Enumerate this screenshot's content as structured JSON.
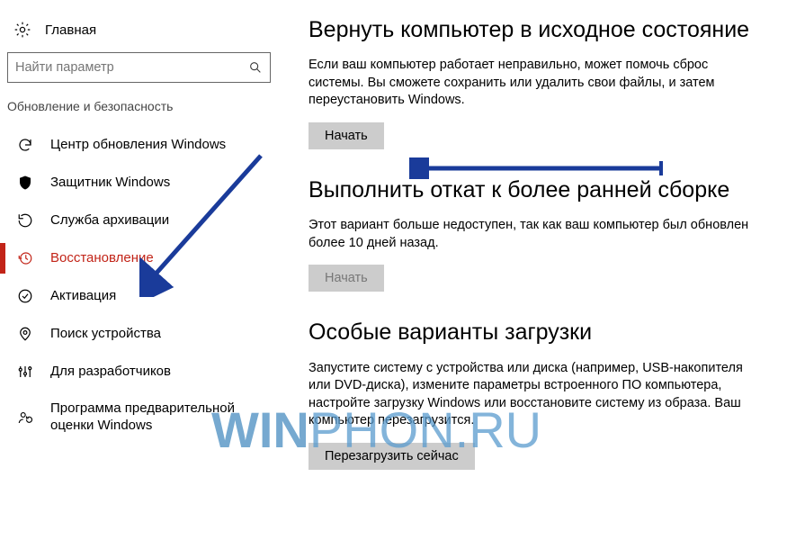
{
  "sidebar": {
    "home_label": "Главная",
    "search_placeholder": "Найти параметр",
    "category": "Обновление и безопасность",
    "items": [
      {
        "label": "Центр обновления Windows"
      },
      {
        "label": "Защитник Windows"
      },
      {
        "label": "Служба архивации"
      },
      {
        "label": "Восстановление"
      },
      {
        "label": "Активация"
      },
      {
        "label": "Поиск устройства"
      },
      {
        "label": "Для разработчиков"
      },
      {
        "label": "Программа предварительной оценки Windows"
      }
    ]
  },
  "sections": {
    "reset": {
      "title": "Вернуть компьютер в исходное состояние",
      "desc": "Если ваш компьютер работает неправильно, может помочь сброс системы. Вы сможете сохранить или удалить свои файлы, и затем переустановить Windows.",
      "button": "Начать"
    },
    "rollback": {
      "title": "Выполнить откат к более ранней сборке",
      "desc": "Этот вариант больше недоступен, так как ваш компьютер был обновлен более 10 дней назад.",
      "button": "Начать"
    },
    "advanced": {
      "title": "Особые варианты загрузки",
      "desc": "Запустите систему с устройства или диска (например, USB-накопителя или DVD-диска), измените параметры встроенного ПО компьютера, настройте загрузку Windows или восстановите систему из образа. Ваш компьютер перезагрузится.",
      "button": "Перезагрузить сейчас"
    }
  },
  "watermark": {
    "a": "WIN",
    "b": "PHON.RU"
  }
}
